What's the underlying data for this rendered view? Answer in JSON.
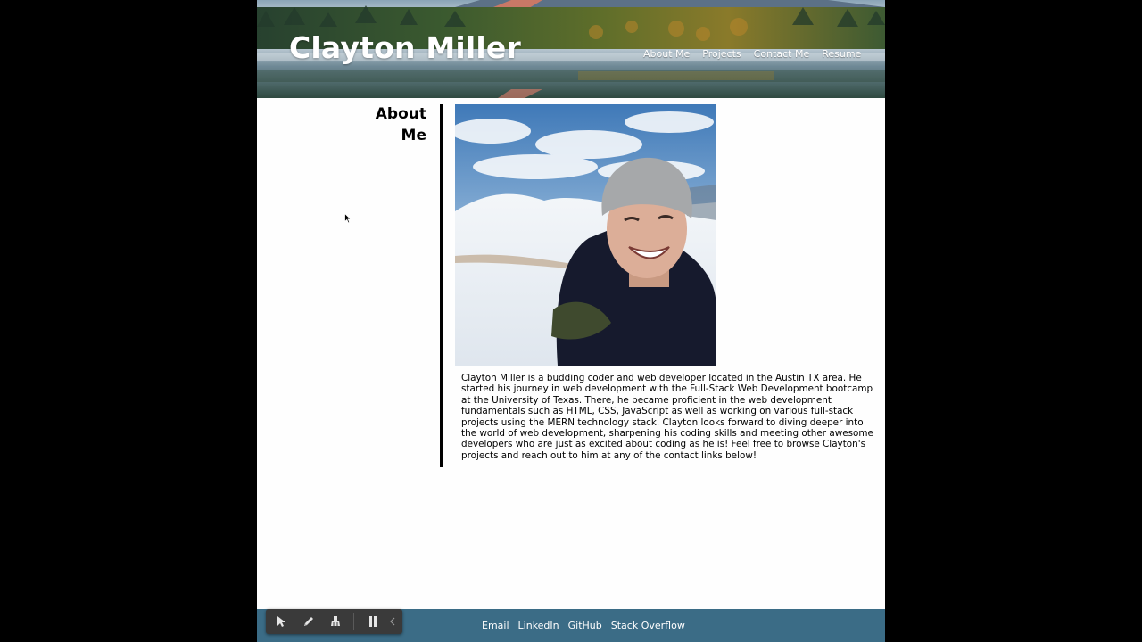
{
  "site": {
    "title": "Clayton Miller"
  },
  "nav": {
    "items": [
      {
        "label": "About Me"
      },
      {
        "label": "Projects"
      },
      {
        "label": "Contact Me"
      },
      {
        "label": "Resume"
      }
    ]
  },
  "about": {
    "heading": "About Me",
    "photo_alt": "profile-photo",
    "bio": "Clayton Miller is a budding coder and web developer located in the Austin TX area. He started his journey in web development with the Full-Stack Web Development bootcamp at the University of Texas. There, he became proficient in the web development fundamentals such as HTML, CSS, JavaScript as well as working on various full-stack projects using the MERN technology stack. Clayton looks forward to diving deeper into the world of web development, sharpening his coding skills and meeting other awesome developers who are just as excited about coding as he is! Feel free to browse Clayton's projects and reach out to him at any of the contact links below!"
  },
  "footer": {
    "links": [
      {
        "label": "Email"
      },
      {
        "label": "LinkedIn"
      },
      {
        "label": "GitHub"
      },
      {
        "label": "Stack Overflow"
      }
    ]
  },
  "recording_toolbar": {
    "tools": [
      "cursor-icon",
      "pen-icon",
      "eraser-icon",
      "pause-icon",
      "collapse-icon"
    ]
  },
  "colors": {
    "footer_bg": "#3b6c86",
    "page_bg": "#fefefe",
    "outer_bg": "#000000",
    "toolbar_bg": "#3a3a3a"
  }
}
